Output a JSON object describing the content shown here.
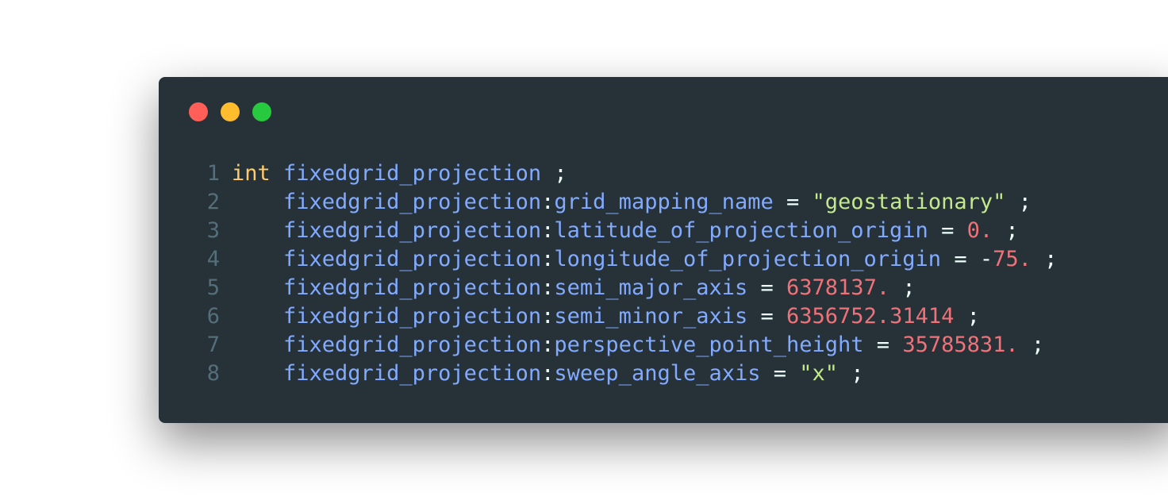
{
  "window": {
    "controls": [
      {
        "name": "close",
        "color": "#ff5f56"
      },
      {
        "name": "minimize",
        "color": "#ffbd2e"
      },
      {
        "name": "maximize",
        "color": "#27c93f"
      }
    ]
  },
  "theme": {
    "keyword": "#ffcb6b",
    "identifier": "#82aaff",
    "attribute": "#82aaff",
    "string": "#c3e88d",
    "number": "#f07178",
    "plain": "#eeffff",
    "line_number": "#546e7a"
  },
  "code": {
    "lines": [
      {
        "number": "1",
        "tokens": [
          {
            "t": "int",
            "k": "keyword"
          },
          {
            "t": " ",
            "k": "plain"
          },
          {
            "t": "fixedgrid_projection",
            "k": "identifier"
          },
          {
            "t": " ;",
            "k": "plain"
          }
        ]
      },
      {
        "number": "2",
        "tokens": [
          {
            "t": "    fixedgrid_projection",
            "k": "identifier"
          },
          {
            "t": ":",
            "k": "plain"
          },
          {
            "t": "grid_mapping_name",
            "k": "attribute"
          },
          {
            "t": " = ",
            "k": "plain"
          },
          {
            "t": "\"geostationary\"",
            "k": "string"
          },
          {
            "t": " ;",
            "k": "plain"
          }
        ]
      },
      {
        "number": "3",
        "tokens": [
          {
            "t": "    fixedgrid_projection",
            "k": "identifier"
          },
          {
            "t": ":",
            "k": "plain"
          },
          {
            "t": "latitude_of_projection_origin",
            "k": "attribute"
          },
          {
            "t": " = ",
            "k": "plain"
          },
          {
            "t": "0.",
            "k": "number"
          },
          {
            "t": " ;",
            "k": "plain"
          }
        ]
      },
      {
        "number": "4",
        "tokens": [
          {
            "t": "    fixedgrid_projection",
            "k": "identifier"
          },
          {
            "t": ":",
            "k": "plain"
          },
          {
            "t": "longitude_of_projection_origin",
            "k": "attribute"
          },
          {
            "t": " = -",
            "k": "plain"
          },
          {
            "t": "75.",
            "k": "number"
          },
          {
            "t": " ;",
            "k": "plain"
          }
        ]
      },
      {
        "number": "5",
        "tokens": [
          {
            "t": "    fixedgrid_projection",
            "k": "identifier"
          },
          {
            "t": ":",
            "k": "plain"
          },
          {
            "t": "semi_major_axis",
            "k": "attribute"
          },
          {
            "t": " = ",
            "k": "plain"
          },
          {
            "t": "6378137.",
            "k": "number"
          },
          {
            "t": " ;",
            "k": "plain"
          }
        ]
      },
      {
        "number": "6",
        "tokens": [
          {
            "t": "    fixedgrid_projection",
            "k": "identifier"
          },
          {
            "t": ":",
            "k": "plain"
          },
          {
            "t": "semi_minor_axis",
            "k": "attribute"
          },
          {
            "t": " = ",
            "k": "plain"
          },
          {
            "t": "6356752.31414",
            "k": "number"
          },
          {
            "t": " ;",
            "k": "plain"
          }
        ]
      },
      {
        "number": "7",
        "tokens": [
          {
            "t": "    fixedgrid_projection",
            "k": "identifier"
          },
          {
            "t": ":",
            "k": "plain"
          },
          {
            "t": "perspective_point_height",
            "k": "attribute"
          },
          {
            "t": " = ",
            "k": "plain"
          },
          {
            "t": "35785831.",
            "k": "number"
          },
          {
            "t": " ;",
            "k": "plain"
          }
        ]
      },
      {
        "number": "8",
        "tokens": [
          {
            "t": "    fixedgrid_projection",
            "k": "identifier"
          },
          {
            "t": ":",
            "k": "plain"
          },
          {
            "t": "sweep_angle_axis",
            "k": "attribute"
          },
          {
            "t": " = ",
            "k": "plain"
          },
          {
            "t": "\"x\"",
            "k": "string"
          },
          {
            "t": " ;",
            "k": "plain"
          }
        ]
      }
    ]
  }
}
